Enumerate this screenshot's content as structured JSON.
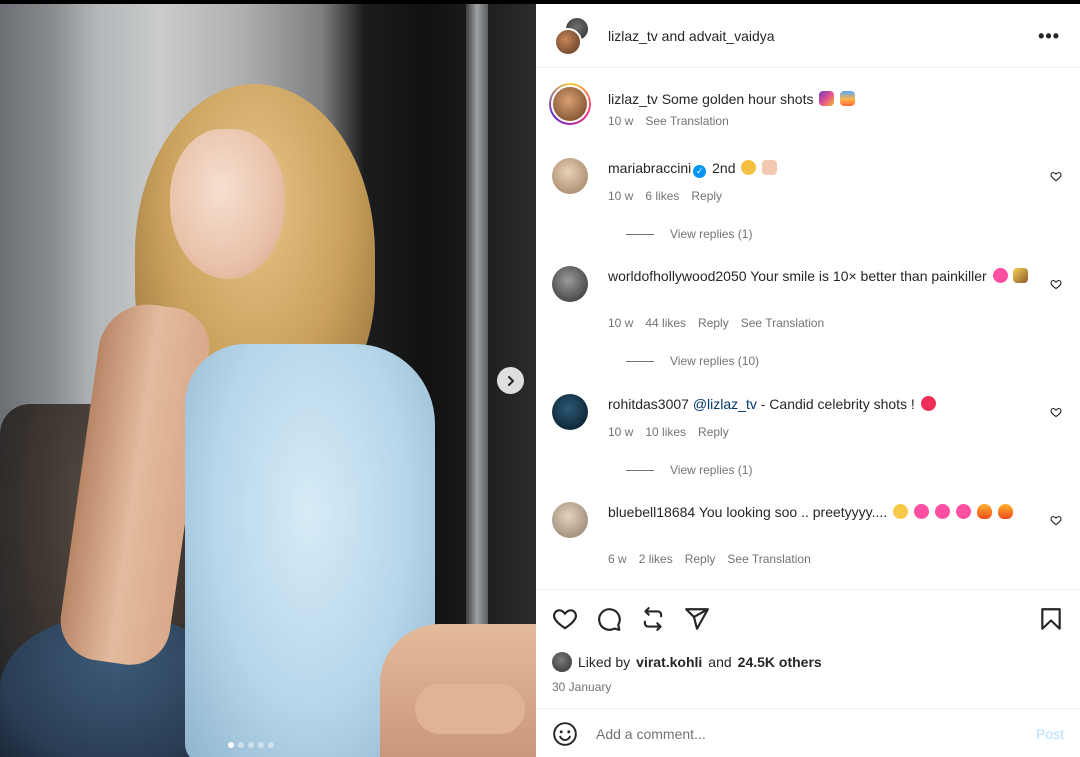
{
  "post": {
    "header_title": "lizlaz_tv and advait_vaidya",
    "more_icon": "more-horizontal-icon",
    "carousel": {
      "slide_count": 5,
      "active_slide": 1
    }
  },
  "comments": [
    {
      "user": "lizlaz_tv",
      "text": "Some golden hour shots",
      "emojis": [
        "night-city-emoji",
        "sunrise-emoji"
      ],
      "time": "10 w",
      "links": [
        "See Translation"
      ],
      "is_caption": true
    },
    {
      "user": "mariabraccini",
      "verified": true,
      "text": "2nd",
      "emojis": [
        "hugging-face-emoji",
        "heart-hands-emoji"
      ],
      "time": "10 w",
      "likes": "6 likes",
      "links": [
        "Reply"
      ],
      "replies": "View replies (1)"
    },
    {
      "user": "worldofhollywood2050",
      "text": "Your smile is 10× better than painkiller",
      "emojis": [
        "pink-heart-emoji",
        "magic-wand-emoji"
      ],
      "time": "10 w",
      "likes": "44 likes",
      "links": [
        "Reply",
        "See Translation"
      ],
      "replies": "View replies (10)"
    },
    {
      "user": "rohitdas3007",
      "mention": "@lizlaz_tv",
      "text": "- Candid celebrity shots !",
      "emojis": [
        "red-heart-emoji"
      ],
      "time": "10 w",
      "likes": "10 likes",
      "links": [
        "Reply"
      ],
      "replies": "View replies (1)"
    },
    {
      "user": "bluebell18684",
      "text": "You looking soo .. preetyyyy....",
      "emojis": [
        "heart-eyes-emoji",
        "pink-heart-emoji",
        "pink-heart-emoji",
        "pink-heart-emoji",
        "fire-emoji",
        "fire-emoji"
      ],
      "time": "6 w",
      "likes": "2 likes",
      "links": [
        "Reply",
        "See Translation"
      ]
    }
  ],
  "actions": {
    "like_icon": "heart-outline-icon",
    "comment_icon": "comment-icon",
    "repost_icon": "repost-icon",
    "share_icon": "send-icon",
    "save_icon": "bookmark-icon"
  },
  "likes_line": {
    "prefix": "Liked by",
    "user": "virat.kohli",
    "middle": "and",
    "count": "24.5K others"
  },
  "date": "30 January",
  "add_comment": {
    "placeholder": "Add a comment...",
    "post_label": "Post"
  },
  "colors": {
    "link_blue": "#00376b",
    "verified_blue": "#0095f6",
    "post_disabled": "#b2dffc",
    "secondary_text": "#737373"
  }
}
